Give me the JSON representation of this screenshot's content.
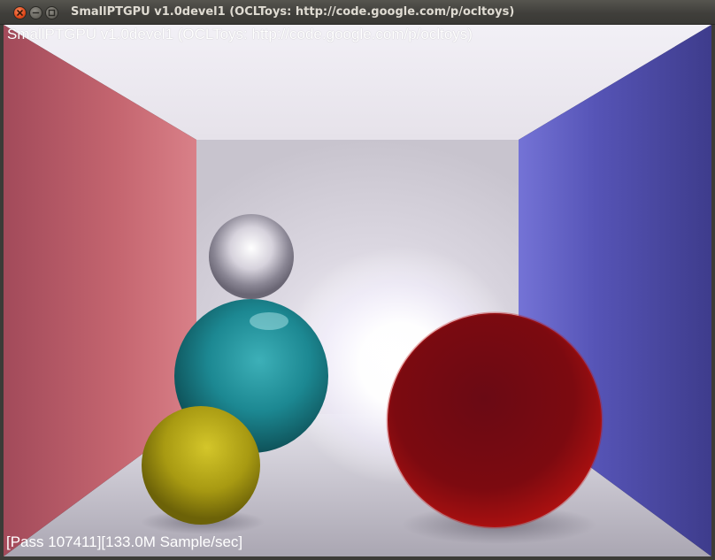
{
  "window": {
    "title": "SmallPTGPU v1.0devel1 (OCLToys: http://code.google.com/p/ocltoys)",
    "buttons": {
      "close_icon": "close-icon",
      "minimize_icon": "minimize-icon",
      "maximize_icon": "maximize-icon"
    }
  },
  "render": {
    "overlay_title": "SmallPTGPU v1.0devel1 (OCLToys: http://code.google.com/p/ocltoys)",
    "status": "[Pass 107411][133.0M Sample/sec]"
  },
  "colors": {
    "left_wall": "#b85a68",
    "right_wall": "#5452b8",
    "back_wall": "#d4d0dc",
    "floor": "#b8b4c0",
    "sphere_mirror": "#c8c8d0",
    "sphere_cyan": "#1e8a94",
    "sphere_yellow": "#a89a10",
    "sphere_red": "#8a0a10"
  }
}
